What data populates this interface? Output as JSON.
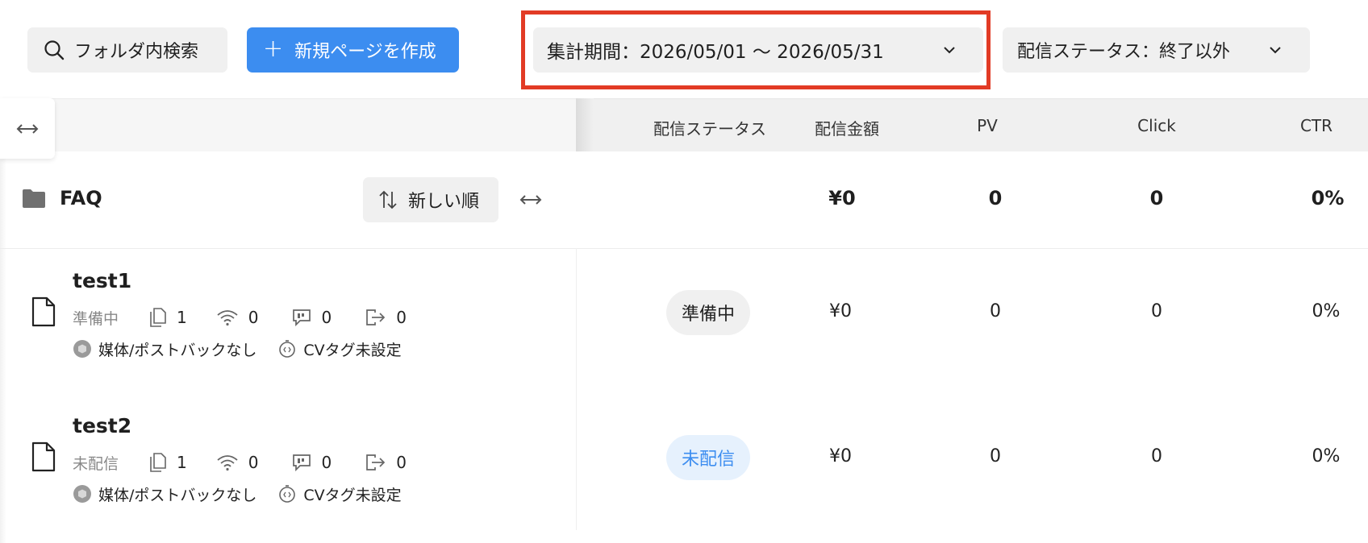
{
  "toolbar": {
    "search_label": "フォルダ内検索",
    "new_page_label": "新規ページを作成",
    "period_label": "集計期間：2026/05/01 〜 2026/05/31",
    "status_filter_label": "配信ステータス：終了以外"
  },
  "table": {
    "columns": [
      "配信ステータス",
      "配信金額",
      "PV",
      "Click",
      "CTR"
    ]
  },
  "folder": {
    "name": "FAQ",
    "sort_label": "新しい順",
    "amount": "¥0",
    "pv": "0",
    "click": "0",
    "ctr": "0%"
  },
  "pages": [
    {
      "title": "test1",
      "status_text": "準備中",
      "copies": "1",
      "signals": "0",
      "comments": "0",
      "exits": "0",
      "media_label": "媒体/ポストバックなし",
      "cv_label": "CVタグ未設定",
      "status_pill": "準備中",
      "amount": "¥0",
      "pv": "0",
      "click": "0",
      "ctr": "0%"
    },
    {
      "title": "test2",
      "status_text": "未配信",
      "copies": "1",
      "signals": "0",
      "comments": "0",
      "exits": "0",
      "media_label": "媒体/ポストバックなし",
      "cv_label": "CVタグ未設定",
      "status_pill": "未配信",
      "amount": "¥0",
      "pv": "0",
      "click": "0",
      "ctr": "0%"
    }
  ],
  "colors": {
    "primary": "#3c8df0",
    "highlight": "#e23b25",
    "pill_blue_bg": "#e6f1fd",
    "pill_gray_bg": "#f0f0f0"
  },
  "icons": [
    "search-icon",
    "plus-icon",
    "chevron-down-icon",
    "expand-horizontal-icon",
    "folder-icon",
    "sort-icon",
    "file-icon",
    "copy-icon",
    "wifi-icon",
    "comment-icon",
    "exit-icon",
    "media-icon",
    "cv-tag-icon"
  ]
}
